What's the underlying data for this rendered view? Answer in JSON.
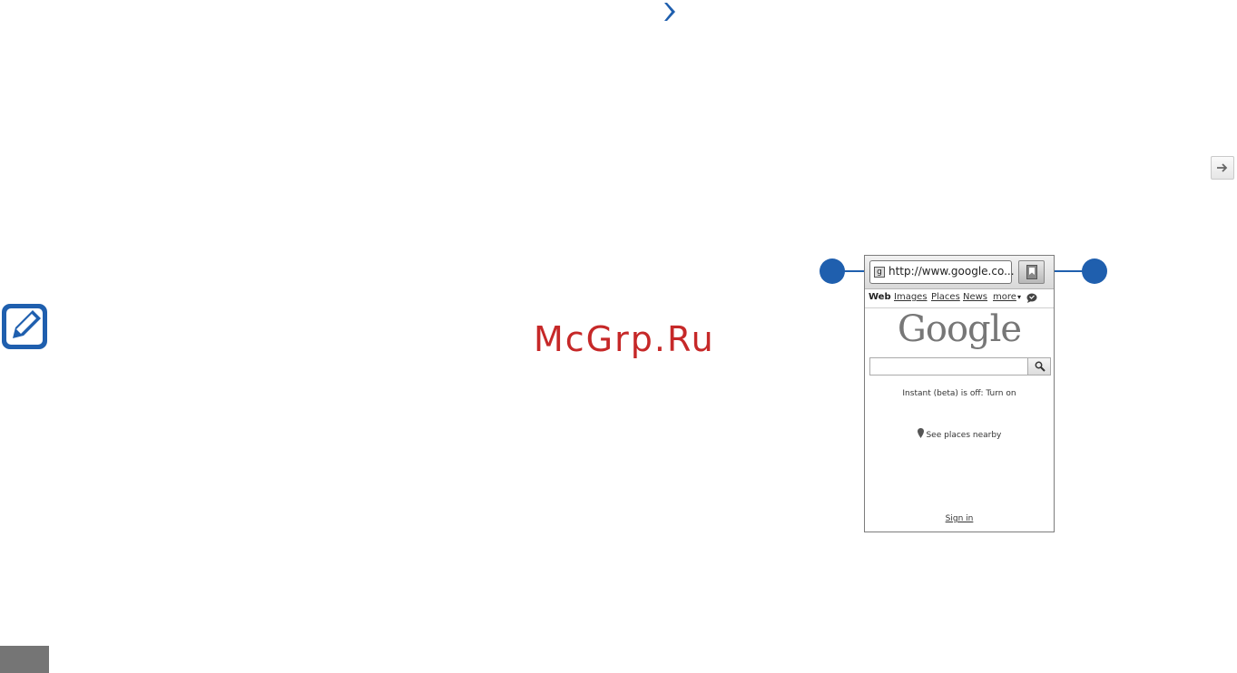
{
  "watermark": "McGrp.Ru",
  "browser": {
    "url": "http://www.google.co...",
    "favicon_glyph": "g",
    "nav": {
      "web": "Web",
      "images": "Images",
      "places": "Places",
      "news": "News",
      "more": "more",
      "more_arrow": "▾"
    },
    "logo": "Google",
    "instant_text": "Instant (beta) is off: Turn on",
    "places_nearby": "See places nearby",
    "sign_in": "Sign in"
  },
  "colors": {
    "accent_blue": "#1f5fae",
    "watermark_red": "#c62828",
    "page_tab_gray": "#757575"
  },
  "icons": [
    "chevron-right-icon",
    "arrow-right-icon",
    "note-pencil-icon",
    "bookmark-icon",
    "search-icon",
    "map-pin-icon",
    "chat-bubble-icon"
  ]
}
